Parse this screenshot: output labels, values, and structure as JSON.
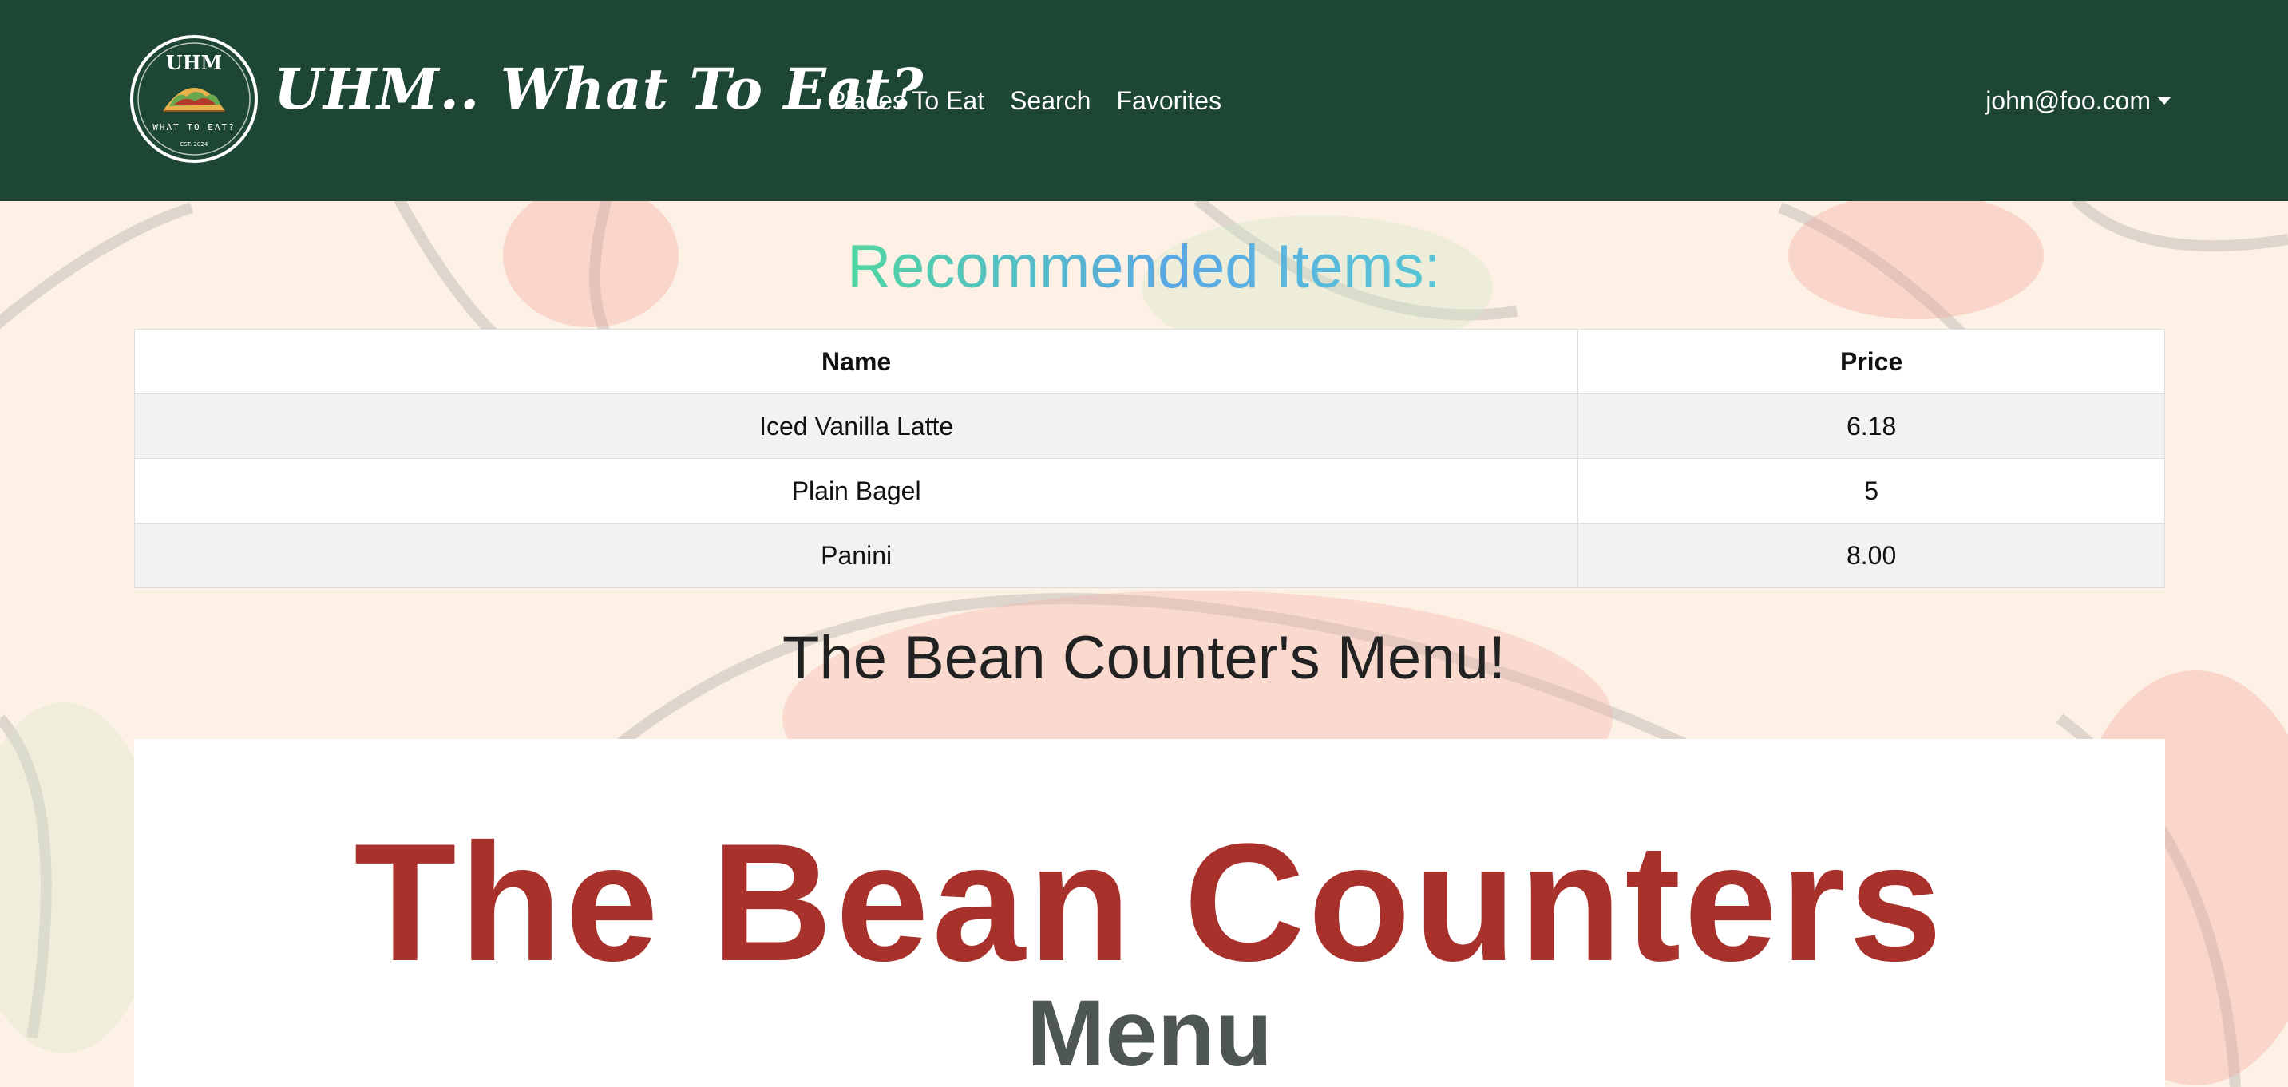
{
  "navbar": {
    "logo": {
      "top_text": "UHM",
      "bottom_text": "WHAT TO EAT?",
      "est_text": "EST. 2024"
    },
    "brand": "UHM.. What To Eat?",
    "links": [
      "Places To Eat",
      "Search",
      "Favorites"
    ],
    "user": "john@foo.com"
  },
  "recommended": {
    "title": "Recommended Items:",
    "headers": [
      "Name",
      "Price"
    ],
    "rows": [
      [
        "Iced Vanilla Latte",
        "6.18"
      ],
      [
        "Plain Bagel",
        "5"
      ],
      [
        "Panini",
        "8.00"
      ]
    ]
  },
  "menu": {
    "heading": "The Bean Counter's Menu!",
    "image_title": "The Bean Counters",
    "image_subtitle": "Menu"
  },
  "colors": {
    "navbar": "#1e4634",
    "background": "#fdf1e6",
    "menu_title": "#a8312b",
    "menu_subtitle": "#4f5756"
  }
}
